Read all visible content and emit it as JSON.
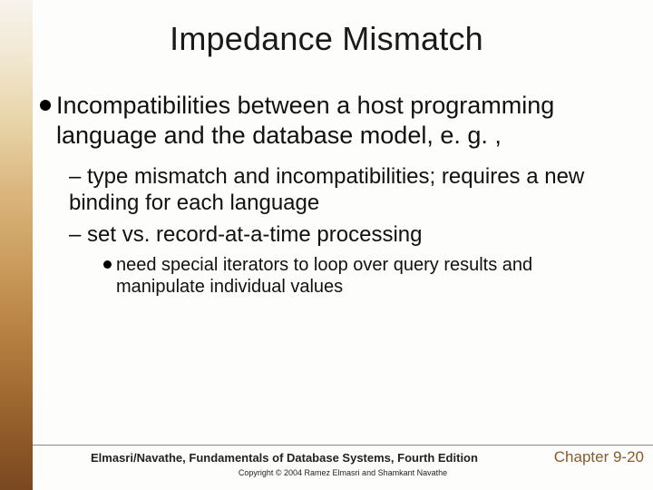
{
  "title": "Impedance Mismatch",
  "bullets": {
    "l1_text": "Incompatibilities between a host programming language and the database model, e. g. ,",
    "l2a": "type mismatch and incompatibilities; requires a new binding for each language",
    "l2b": "set vs. record-at-a-time processing",
    "l3a": "need special iterators to loop over query results and manipulate individual values"
  },
  "footer": {
    "book": "Elmasri/Navathe, Fundamentals of Database Systems, Fourth Edition",
    "chapter": "Chapter 9-20",
    "copyright": "Copyright © 2004 Ramez Elmasri and Shamkant Navathe"
  }
}
